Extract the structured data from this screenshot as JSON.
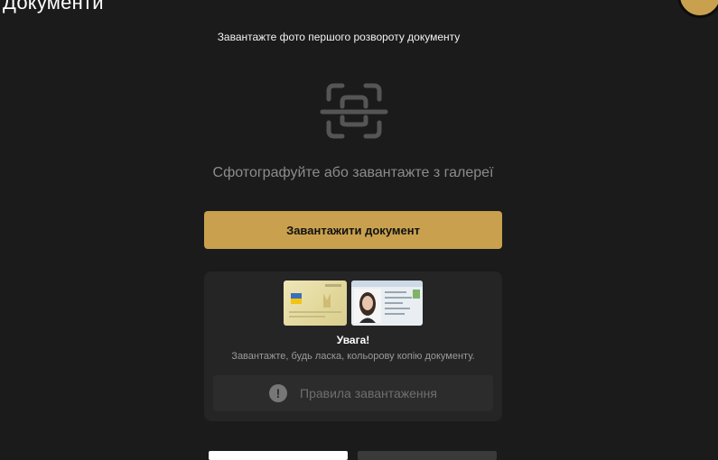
{
  "header": {
    "title": "Документи"
  },
  "user": {
    "avatar_color": "#c9a14e"
  },
  "upload": {
    "subtitle": "Завантажте фото першого розвороту документу",
    "scan_icon": "document-scan-icon",
    "hint": "Сфотографуйте або завантажте з галереї",
    "button_label": "Завантажити документ"
  },
  "warning": {
    "title": "Увага!",
    "text": "Завантажте, будь ласка, кольорову копію документу.",
    "rules_icon": "exclamation-circle-icon",
    "rules_label": "Правила завантаження"
  },
  "colors": {
    "accent": "#c9a14e",
    "background": "#1b1b1b",
    "card": "#252525"
  }
}
